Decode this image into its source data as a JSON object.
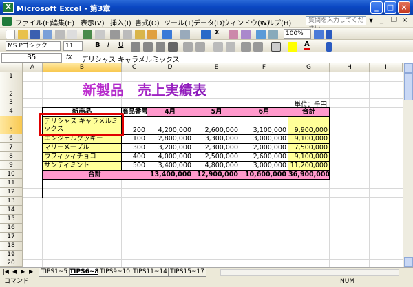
{
  "window": {
    "title": "Microsoft Excel - 第3章"
  },
  "menu": [
    "ファイル(F)",
    "編集(E)",
    "表示(V)",
    "挿入(I)",
    "書式(O)",
    "ツール(T)",
    "データ(D)",
    "ウィンドウ(W)",
    "ヘルプ(H)"
  ],
  "help_placeholder": "質問を入力してください",
  "toolbar": {
    "zoom": "100%",
    "font": "MS Pゴシック",
    "size": "11",
    "bold": "B",
    "italic": "I",
    "underline": "U",
    "autosum": "Σ",
    "fontcolor": "A"
  },
  "formula": {
    "name_box": "B5",
    "fx": "fx",
    "content": "デリシャス キャラメルミックス"
  },
  "columns": [
    "A",
    "B",
    "C",
    "D",
    "E",
    "F",
    "G",
    "H",
    "I"
  ],
  "rows": [
    "1",
    "2",
    "3",
    "4",
    "5",
    "6",
    "7",
    "8",
    "9",
    "10",
    "11",
    "12",
    "13",
    "14",
    "15",
    "16",
    "17",
    "18",
    "19",
    "20"
  ],
  "sheet": {
    "title": "新製品　売上実績表",
    "unit": "単位：千円",
    "headers": [
      "新商品",
      "商品番号",
      "4月",
      "5月",
      "6月",
      "合計"
    ],
    "data": [
      [
        "デリシャス キャラメルミックス",
        "200",
        "4,200,000",
        "2,600,000",
        "3,100,000",
        "9,900,000"
      ],
      [
        "エンジェルクッキー",
        "100",
        "2,800,000",
        "3,300,000",
        "3,000,000",
        "9,100,000"
      ],
      [
        "マリーメープル",
        "300",
        "3,200,000",
        "2,300,000",
        "2,000,000",
        "7,500,000"
      ],
      [
        "ウフィッィチョコ",
        "400",
        "4,000,000",
        "2,500,000",
        "2,600,000",
        "9,100,000"
      ],
      [
        "サンティミント",
        "500",
        "3,400,000",
        "4,800,000",
        "3,000,000",
        "11,200,000"
      ]
    ],
    "total": [
      "合計",
      "13,400,000",
      "12,900,000",
      "10,600,000",
      "36,900,000"
    ]
  },
  "tabs": [
    "TIPS1~5",
    "TIPS6~8",
    "TIPS9~10",
    "TIPS11~14",
    "TIPS15~17"
  ],
  "active_tab": "TIPS6~8",
  "status": {
    "left": "コマンド",
    "right": "NUM"
  },
  "colors": {
    "title_gradient": "#a020c0",
    "highlight_red": "#e00000",
    "yellow": "#ffff99",
    "pink": "#ff99cc"
  }
}
